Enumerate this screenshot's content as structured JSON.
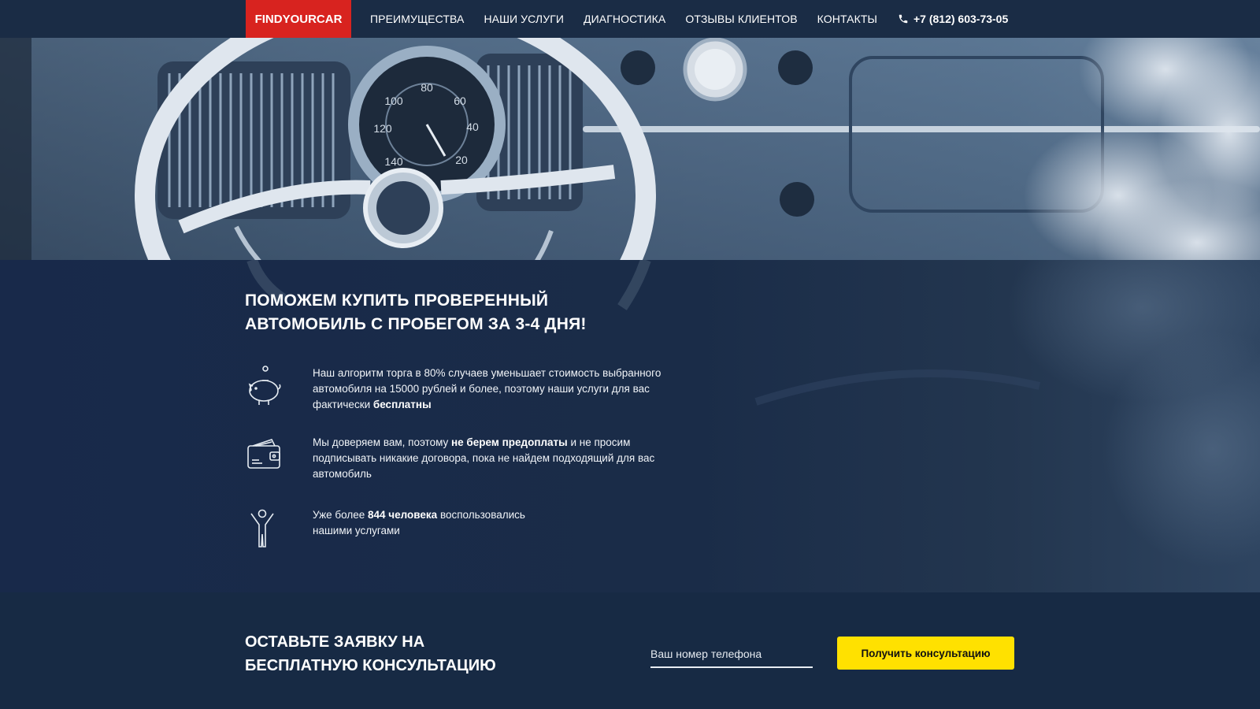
{
  "nav": {
    "logo": "FINDYOURCAR",
    "items": [
      "ПРЕИМУЩЕСТВА",
      "НАШИ УСЛУГИ",
      "ДИАГНОСТИКА",
      "ОТЗЫВЫ КЛИЕНТОВ",
      "КОНТАКТЫ"
    ],
    "phone": "+7 (812) 603-73-05",
    "phone_icon": "phone-icon"
  },
  "hero": {
    "headline_line1": "ПОМОЖЕМ КУПИТЬ ПРОВЕРЕННЫЙ",
    "headline_line2": "АВТОМОБИЛЬ С ПРОБЕГОМ ЗА 3-4 ДНЯ!",
    "speedometer_labels": [
      "100",
      "80",
      "60",
      "120",
      "40",
      "140",
      "20"
    ]
  },
  "features": [
    {
      "icon": "piggy-bank-icon",
      "text_plain": "Наш алгоритм торга в 80% случаев уменьшает стоимость выбранного автомобиля на 15000 рублей и более, поэтому наши услуги для вас фактически ",
      "text_bold": "бесплатны"
    },
    {
      "icon": "wallet-icon",
      "text_before": "Мы доверяем вам, поэтому ",
      "text_bold": "не берем предоплаты",
      "text_after": " и не просим подписывать никакие договора, пока не найдем подходящий для вас автомобиль"
    },
    {
      "icon": "person-icon",
      "text_before": "Уже более ",
      "text_bold": "844 человека",
      "text_after": " воспользовались нашими услугами"
    }
  ],
  "form": {
    "title_line1": "ОСТАВЬТЕ ЗАЯВКУ НА",
    "title_line2": "БЕСПЛАТНУЮ КОНСУЛЬТАЦИЮ",
    "phone_placeholder": "Ваш номер телефона",
    "submit_label": "Получить консультацию"
  },
  "colors": {
    "logo_bg": "#d8231f",
    "nav_bg": "#1a2c45",
    "main_bg": "#172a44",
    "cta_bg": "#ffe100"
  }
}
